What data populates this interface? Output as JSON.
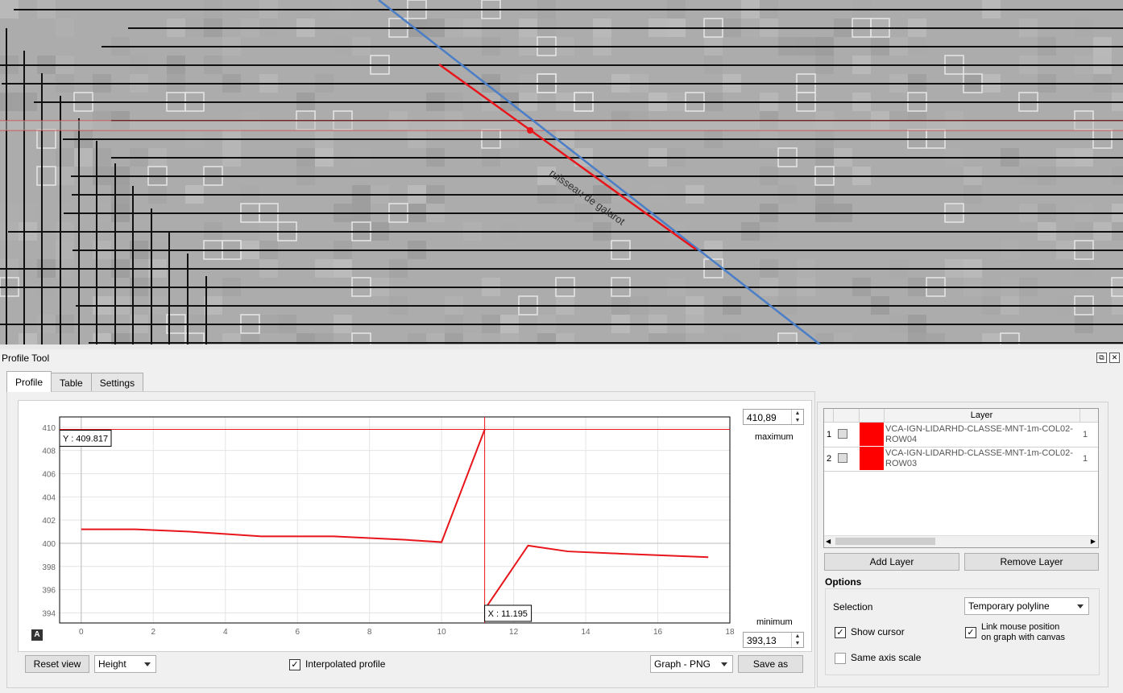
{
  "map": {
    "stream_label": "ruisseau de galarot",
    "colors": {
      "raster": "#acacac",
      "stream": "#4a7ec7",
      "profile": "#e8151b"
    }
  },
  "dock": {
    "title": "Profile Tool",
    "float_icon": "float-icon",
    "close_icon": "close-icon"
  },
  "tabs": [
    {
      "label": "Profile",
      "active": true
    },
    {
      "label": "Table",
      "active": false
    },
    {
      "label": "Settings",
      "active": false
    }
  ],
  "axis_spins": {
    "maximum_value": "410,89",
    "maximum_label": "maximum",
    "minimum_value": "393,13",
    "minimum_label": "minimum"
  },
  "chart_data": {
    "type": "line",
    "xlim": [
      -0.6,
      18
    ],
    "ylim": [
      393.13,
      410.89
    ],
    "x_ticks": [
      "0",
      "2",
      "4",
      "6",
      "8",
      "10",
      "12",
      "14",
      "16",
      "18"
    ],
    "y_ticks": [
      "394",
      "396",
      "398",
      "400",
      "402",
      "404",
      "406",
      "408",
      "410"
    ],
    "series": [
      {
        "color": "#e8151b",
        "x": [
          0,
          1.5,
          3,
          5,
          7,
          9,
          10,
          11.195
        ],
        "y": [
          401.2,
          401.2,
          401.0,
          400.6,
          400.6,
          400.3,
          400.1,
          409.8
        ]
      },
      {
        "color": "#e8151b",
        "x": [
          11.195,
          12.4,
          13.5,
          15,
          17.4
        ],
        "y": [
          394.3,
          399.8,
          399.3,
          399.1,
          398.8
        ]
      }
    ],
    "cursor": {
      "x": 11.195,
      "y": 409.817,
      "x_label": "X : 11.195",
      "y_label": "Y : 409.817"
    }
  },
  "bottom_controls": {
    "reset_view": "Reset view",
    "height_combo": "Height",
    "interpolated_label": "Interpolated profile",
    "interpolated_checked": true,
    "export_combo": "Graph - PNG",
    "save_as": "Save as"
  },
  "layers": {
    "header": "Layer",
    "rows": [
      {
        "num": "1",
        "color": "#ff0000",
        "name": "VCA-IGN-LIDARHD-CLASSE-MNT-1m-COL02-ROW04",
        "band": "1"
      },
      {
        "num": "2",
        "color": "#ff0000",
        "name": "VCA-IGN-LIDARHD-CLASSE-MNT-1m-COL02-ROW03",
        "band": "1"
      }
    ],
    "add_layer": "Add Layer",
    "remove_layer": "Remove Layer"
  },
  "options": {
    "title": "Options",
    "selection_label": "Selection",
    "selection_value": "Temporary polyline",
    "show_cursor": "Show cursor",
    "show_cursor_checked": true,
    "link_mouse_line1": "Link mouse position",
    "link_mouse_line2": "on graph with canvas",
    "link_mouse_checked": true,
    "same_axis_scale": "Same axis scale",
    "same_axis_checked": false
  }
}
